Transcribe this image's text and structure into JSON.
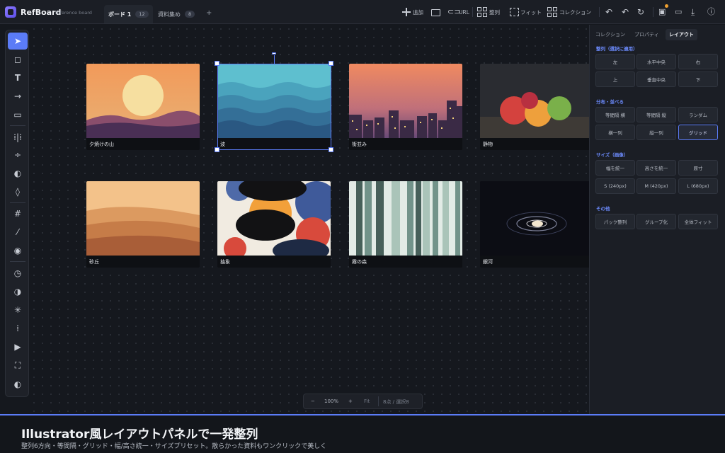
{
  "app": {
    "name": "RefBoard",
    "subtitle": "reference board"
  },
  "tabs": [
    {
      "label": "ボード 1",
      "count": "12",
      "active": true
    },
    {
      "label": "資料集め",
      "count": "8",
      "active": false
    }
  ],
  "toolbar": {
    "add_label": "追加",
    "url_label": "URL",
    "align_label": "整列",
    "fit_label": "フィット",
    "collection_label": "コレクション"
  },
  "tools": [
    "select-tool",
    "note-tool",
    "text-tool",
    "arrow-tool",
    "rect-tool",
    "distribute-h-tool",
    "distribute-v-tool",
    "contrast-tool",
    "drop-tool",
    "grid-tool",
    "eyedropper-tool",
    "palette-tool",
    "history-tool",
    "invert-tool",
    "brightness-tool",
    "pattern-tool",
    "slideshow-tool",
    "fullscreen-tool",
    "theme-tool"
  ],
  "cards": [
    {
      "caption": "夕焼けの山"
    },
    {
      "caption": "波"
    },
    {
      "caption": "街並み"
    },
    {
      "caption": "静物"
    },
    {
      "caption": "砂丘"
    },
    {
      "caption": "抽象"
    },
    {
      "caption": "霧の森"
    },
    {
      "caption": "銀河"
    }
  ],
  "zoom": {
    "minus": "−",
    "level": "100%",
    "plus": "+",
    "fit": "Fit",
    "status": "8点 / 選択8"
  },
  "panel": {
    "tabs": [
      "コレクション",
      "プロパティ",
      "レイアウト"
    ],
    "active_tab": 2,
    "sections": {
      "align_title": "整列（選択に適用）",
      "align_buttons": [
        "左",
        "水平中央",
        "右",
        "上",
        "垂直中央",
        "下"
      ],
      "distribute_title": "分布・並べる",
      "distribute_buttons": [
        "等間隔 横",
        "等間隔 縦",
        "ランダム",
        "横一列",
        "縦一列",
        "グリッド"
      ],
      "size_title": "サイズ（画像）",
      "size_buttons": [
        "幅を統一",
        "高さを統一",
        "原寸",
        "S (240px)",
        "M (420px)",
        "L (680px)"
      ],
      "other_title": "その他",
      "other_buttons": [
        "パック整列",
        "グループ化",
        "全体フィット"
      ]
    }
  },
  "caption": {
    "headline": "Illustrator風レイアウトパネルで一発整列",
    "sub": "整列6方向・等間隔・グリッド・幅/高さ統一・サイズプリセット。散らかった資料もワンクリックで美しく"
  },
  "colors": {
    "accent": "#5b7cf7",
    "bg": "#15181e",
    "panel": "#1b1e25"
  }
}
